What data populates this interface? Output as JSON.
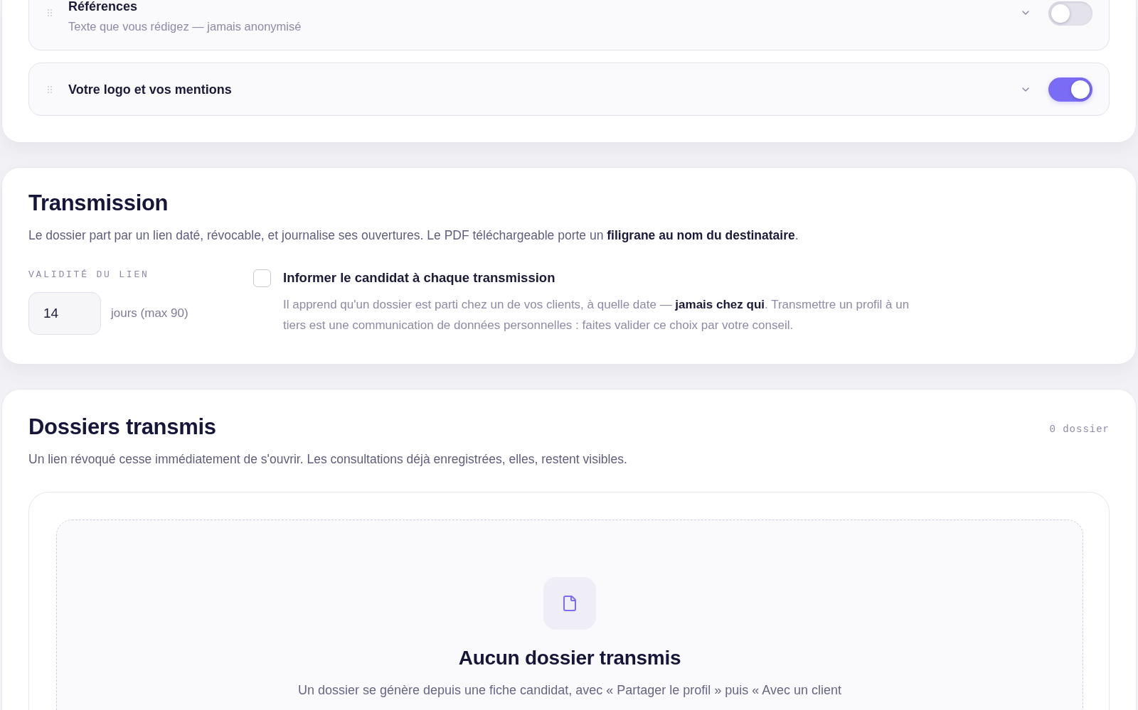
{
  "options_card": {
    "rows": [
      {
        "title": "Références",
        "subtitle": "Texte que vous rédigez — jamais anonymisé",
        "expanded": false,
        "on": false
      },
      {
        "title": "Votre logo et vos mentions",
        "expanded": false,
        "on": true
      }
    ]
  },
  "transmission": {
    "title": "Transmission",
    "description": "Le dossier part par un lien daté, révocable, et journalise ses ouvertures. Le PDF téléchargeable porte un **filigrane au nom du destinataire**.",
    "validity": {
      "label": "VALIDITÉ DU LIEN",
      "value": "14",
      "unit": "jours (max 90)"
    },
    "notify": {
      "label": "Informer le candidat à chaque transmission",
      "checked": false,
      "help": "Il apprend qu'un dossier est parti chez un de vos clients, à quelle date — **jamais chez qui**. Transmettre un profil à un tiers est une communication de données personnelles : faites valider ce choix par votre conseil."
    }
  },
  "sent_files": {
    "title": "Dossiers transmis",
    "count": "0 dossier",
    "description": "Un lien révoqué cesse immédiatement de s'ouvrir. Les consultations déjà enregistrées, elles, restent visibles.",
    "empty_state": {
      "title": "Aucun dossier transmis",
      "text": "Un dossier se génère depuis une fiche candidat, avec « Partager le profil » puis « Avec un client"
    }
  }
}
